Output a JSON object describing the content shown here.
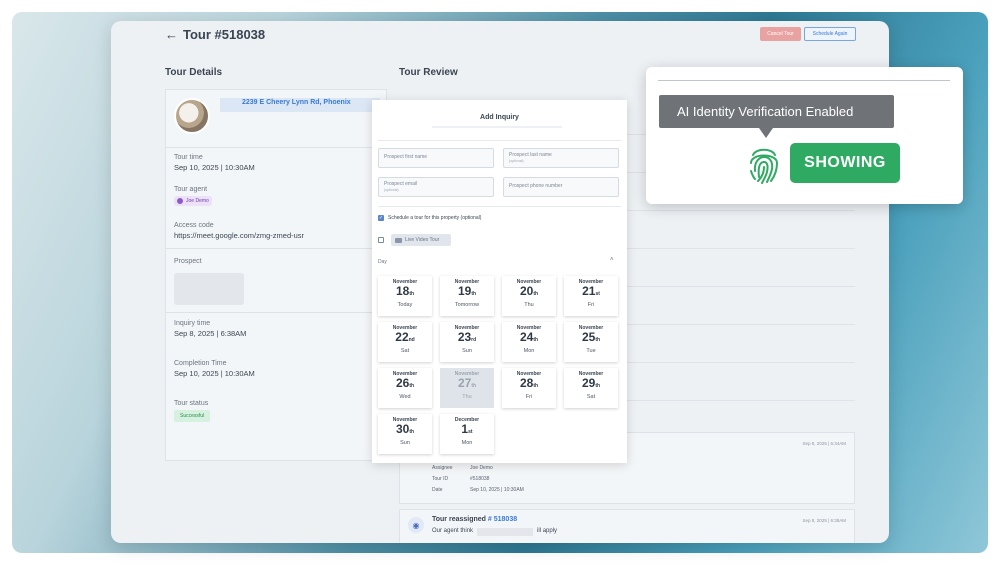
{
  "header": {
    "title": "Tour #518038",
    "cancel_label": "Cancel Tour",
    "again_label": "Schedule Again"
  },
  "details": {
    "section_title": "Tour Details",
    "address": "2239 E Cheery Lynn Rd, Phoenix",
    "tour_time_label": "Tour time",
    "tour_time": "Sep 10, 2025 | 10:30AM",
    "agent_label": "Tour agent",
    "agent_name": "Joe Demo",
    "access_label": "Access code",
    "access_code": "https://meet.google.com/zmg-zmed-usr",
    "prospect_label": "Prospect",
    "inquiry_label": "Inquiry time",
    "inquiry_time": "Sep 8, 2025 | 6:38AM",
    "completion_label": "Completion Time",
    "completion_time": "Sep 10, 2025 | 10:30AM",
    "status_label": "Tour status",
    "status": "Successful"
  },
  "review": {
    "section_title": "Tour Review",
    "feed1": {
      "timestamp": "Sep 8, 2025 | 6:34AM",
      "assignee_label": "Assignee",
      "assignee": "Joe Demo",
      "tourid_label": "Tour ID",
      "tourid": "#518038",
      "date_label": "Date",
      "date": "Sep 10, 2025 | 10:30AM"
    },
    "feed2": {
      "title": "Tour reassigned",
      "link": "# 518038",
      "timestamp": "Sep 8, 2025 | 6:38AM",
      "text_a": "Our agent think",
      "text_b": "ill apply"
    }
  },
  "modal": {
    "title": "Add Inquiry",
    "first_name_ph": "Prospect first name",
    "last_name_ph": "Prospect last name",
    "last_name_opt": "(optional)",
    "email_ph": "Prospect email",
    "email_opt": "(optional)",
    "phone_ph": "Prospect phone number",
    "schedule_label": "Schedule a tour for this property (optional)",
    "video_label": "Live Video Tour",
    "day_label": "Day",
    "days": [
      {
        "month": "November",
        "day": "18",
        "suffix": "th",
        "weekday": "Today",
        "disabled": false
      },
      {
        "month": "November",
        "day": "19",
        "suffix": "th",
        "weekday": "Tomorrow",
        "disabled": false
      },
      {
        "month": "November",
        "day": "20",
        "suffix": "th",
        "weekday": "Thu",
        "disabled": false
      },
      {
        "month": "November",
        "day": "21",
        "suffix": "st",
        "weekday": "Fri",
        "disabled": false
      },
      {
        "month": "November",
        "day": "22",
        "suffix": "nd",
        "weekday": "Sat",
        "disabled": false
      },
      {
        "month": "November",
        "day": "23",
        "suffix": "rd",
        "weekday": "Sun",
        "disabled": false
      },
      {
        "month": "November",
        "day": "24",
        "suffix": "th",
        "weekday": "Mon",
        "disabled": false
      },
      {
        "month": "November",
        "day": "25",
        "suffix": "th",
        "weekday": "Tue",
        "disabled": false
      },
      {
        "month": "November",
        "day": "26",
        "suffix": "th",
        "weekday": "Wed",
        "disabled": false
      },
      {
        "month": "November",
        "day": "27",
        "suffix": "th",
        "weekday": "Thu",
        "disabled": true
      },
      {
        "month": "November",
        "day": "28",
        "suffix": "th",
        "weekday": "Fri",
        "disabled": false
      },
      {
        "month": "November",
        "day": "29",
        "suffix": "th",
        "weekday": "Sat",
        "disabled": false
      },
      {
        "month": "November",
        "day": "30",
        "suffix": "th",
        "weekday": "Sun",
        "disabled": false
      },
      {
        "month": "December",
        "day": "1",
        "suffix": "st",
        "weekday": "Mon",
        "disabled": false
      }
    ]
  },
  "popover": {
    "tooltip": "AI Identity Verification Enabled",
    "status": "SHOWING",
    "status_color": "#2faa62",
    "icon": "fingerprint-icon"
  }
}
